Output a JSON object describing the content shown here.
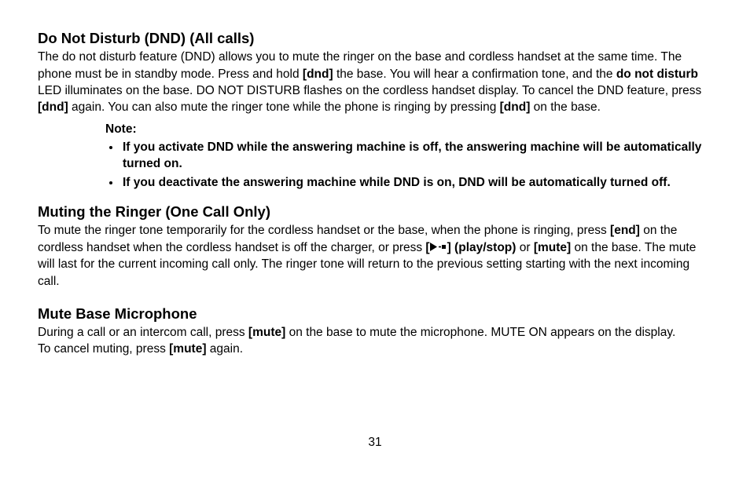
{
  "section1": {
    "heading": "Do Not Disturb (DND) (All calls)",
    "p1a": "The do not disturb feature (DND) allows you to mute the ringer on the base and cordless handset at the same time. The phone must be in standby mode. Press and hold ",
    "p1b_bold": "[dnd]",
    "p1c": " the base. You will hear a confirmation tone, and the ",
    "p1d_bold": "do not disturb",
    "p1e": " LED illuminates on the base. DO NOT DISTURB flashes on the cordless handset display. To cancel the DND feature, press ",
    "p1f_bold": "[dnd]",
    "p1g": " again. You can also mute the ringer tone while the phone is ringing by pressing ",
    "p1h_bold": "[dnd]",
    "p1i": " on the base.",
    "note_label": "Note:",
    "bullet1": "If you activate DND while the answering machine is off, the answering machine will be automatically turned on.",
    "bullet2": "If you deactivate the answering machine while DND is on, DND will be automatically turned off."
  },
  "section2": {
    "heading": "Muting the Ringer (One Call Only)",
    "p1a": "To mute the ringer tone temporarily for the cordless handset or the base, when the phone is ringing, press ",
    "p1b_bold": "[end]",
    "p1c": " on the cordless handset when the cordless handset is off the charger, or press ",
    "p1d_bold_open": "[",
    "p1d_bold_close": "] (play/stop)",
    "p1e": " or ",
    "p1f_bold": "[mute]",
    "p1g": " on the base. The mute will last for the current incoming call only. The ringer tone will return to the previous setting starting with the next incoming call."
  },
  "section3": {
    "heading": "Mute Base Microphone",
    "p1a": "During a call or an intercom call, press ",
    "p1b_bold": "[mute]",
    "p1c": " on the base to mute the microphone. MUTE ON appears on the display.",
    "p2a": "To cancel muting, press ",
    "p2b_bold": "[mute]",
    "p2c": " again."
  },
  "page_number": "31"
}
